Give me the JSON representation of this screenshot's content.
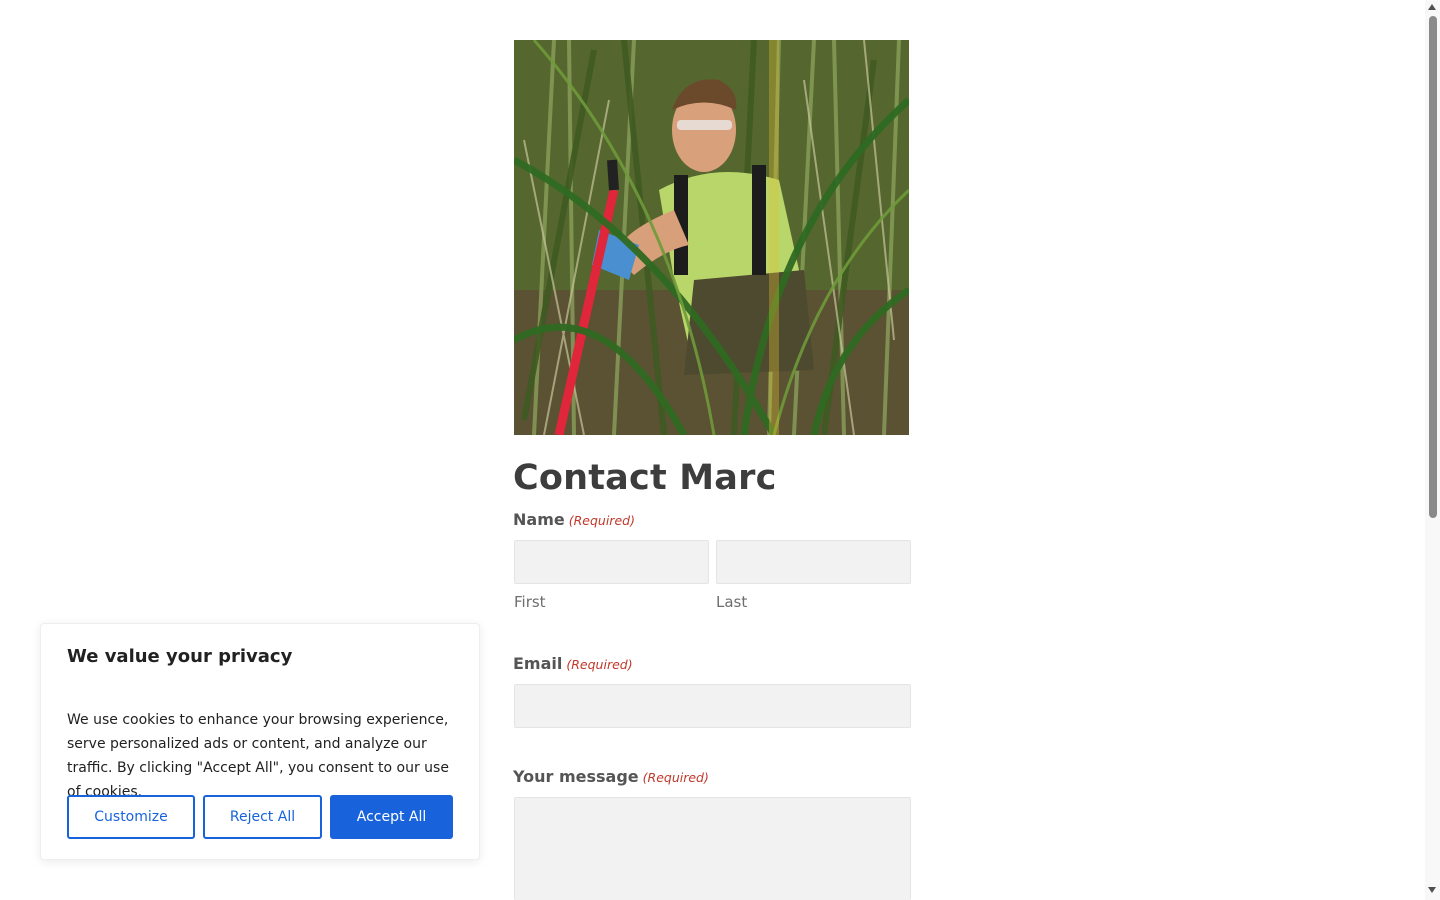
{
  "page": {
    "title": "Contact Marc"
  },
  "form": {
    "required_text": "(Required)",
    "name": {
      "label": "Name",
      "first": {
        "sublabel": "First",
        "value": ""
      },
      "last": {
        "sublabel": "Last",
        "value": ""
      }
    },
    "email": {
      "label": "Email",
      "value": ""
    },
    "message": {
      "label": "Your message",
      "value": ""
    }
  },
  "cookie_banner": {
    "title": "We value your privacy",
    "text": "We use cookies to enhance your browsing experience, serve personalized ads or content, and analyze our traffic. By clicking \"Accept All\", you consent to our use of cookies.",
    "customize_label": "Customize",
    "reject_label": "Reject All",
    "accept_label": "Accept All"
  },
  "colors": {
    "accent": "#1863dc",
    "required": "#c0392b",
    "input_bg": "#f2f2f2"
  },
  "icons": {
    "scroll_up": "triangle-up-icon",
    "scroll_down": "triangle-down-icon"
  }
}
